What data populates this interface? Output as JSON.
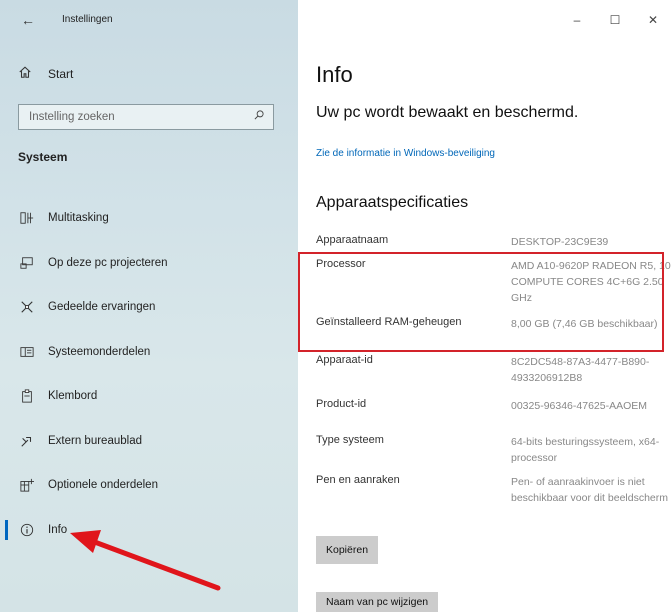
{
  "window": {
    "title": "Instellingen",
    "controls": {
      "minimize": "–",
      "maximize": "☐",
      "close": "✕"
    }
  },
  "sidebar": {
    "home_label": "Start",
    "search_placeholder": "Instelling zoeken",
    "section_title": "Systeem",
    "items": [
      {
        "label": "Multitasking",
        "icon": "multitasking-icon"
      },
      {
        "label": "Op deze pc projecteren",
        "icon": "project-icon"
      },
      {
        "label": "Gedeelde ervaringen",
        "icon": "shared-experiences-icon"
      },
      {
        "label": "Systeemonderdelen",
        "icon": "system-components-icon"
      },
      {
        "label": "Klembord",
        "icon": "clipboard-icon"
      },
      {
        "label": "Extern bureaublad",
        "icon": "remote-desktop-icon"
      },
      {
        "label": "Optionele onderdelen",
        "icon": "optional-features-icon"
      },
      {
        "label": "Info",
        "icon": "info-icon",
        "active": true
      }
    ]
  },
  "main": {
    "title": "Info",
    "protection_status": "Uw pc wordt bewaakt en beschermd.",
    "security_link": "Zie de informatie in Windows-beveiliging",
    "specs_title": "Apparaatspecificaties",
    "specs": [
      {
        "key": "Apparaatnaam",
        "value": "DESKTOP-23C9E39"
      },
      {
        "key": "Processor",
        "value": "AMD A10-9620P RADEON R5, 10 COMPUTE CORES 4C+6G   2.50 GHz"
      },
      {
        "key": "Geïnstalleerd RAM-geheugen",
        "value": "8,00 GB (7,46 GB beschikbaar)"
      },
      {
        "key": "Apparaat-id",
        "value": "8C2DC548-87A3-4477-B890-4933206912B8"
      },
      {
        "key": "Product-id",
        "value": "00325-96346-47625-AAOEM"
      },
      {
        "key": "Type systeem",
        "value": "64-bits besturingssysteem, x64-processor"
      },
      {
        "key": "Pen en aanraken",
        "value": "Pen- of aanraakinvoer is niet beschikbaar voor dit beeldscherm"
      }
    ],
    "copy_button": "Kopiëren",
    "rename_button": "Naam van pc wijzigen"
  },
  "colors": {
    "highlight_box": "#d3232a",
    "arrow": "#e0151b",
    "link": "#0067b8",
    "accent": "#0067c0"
  }
}
